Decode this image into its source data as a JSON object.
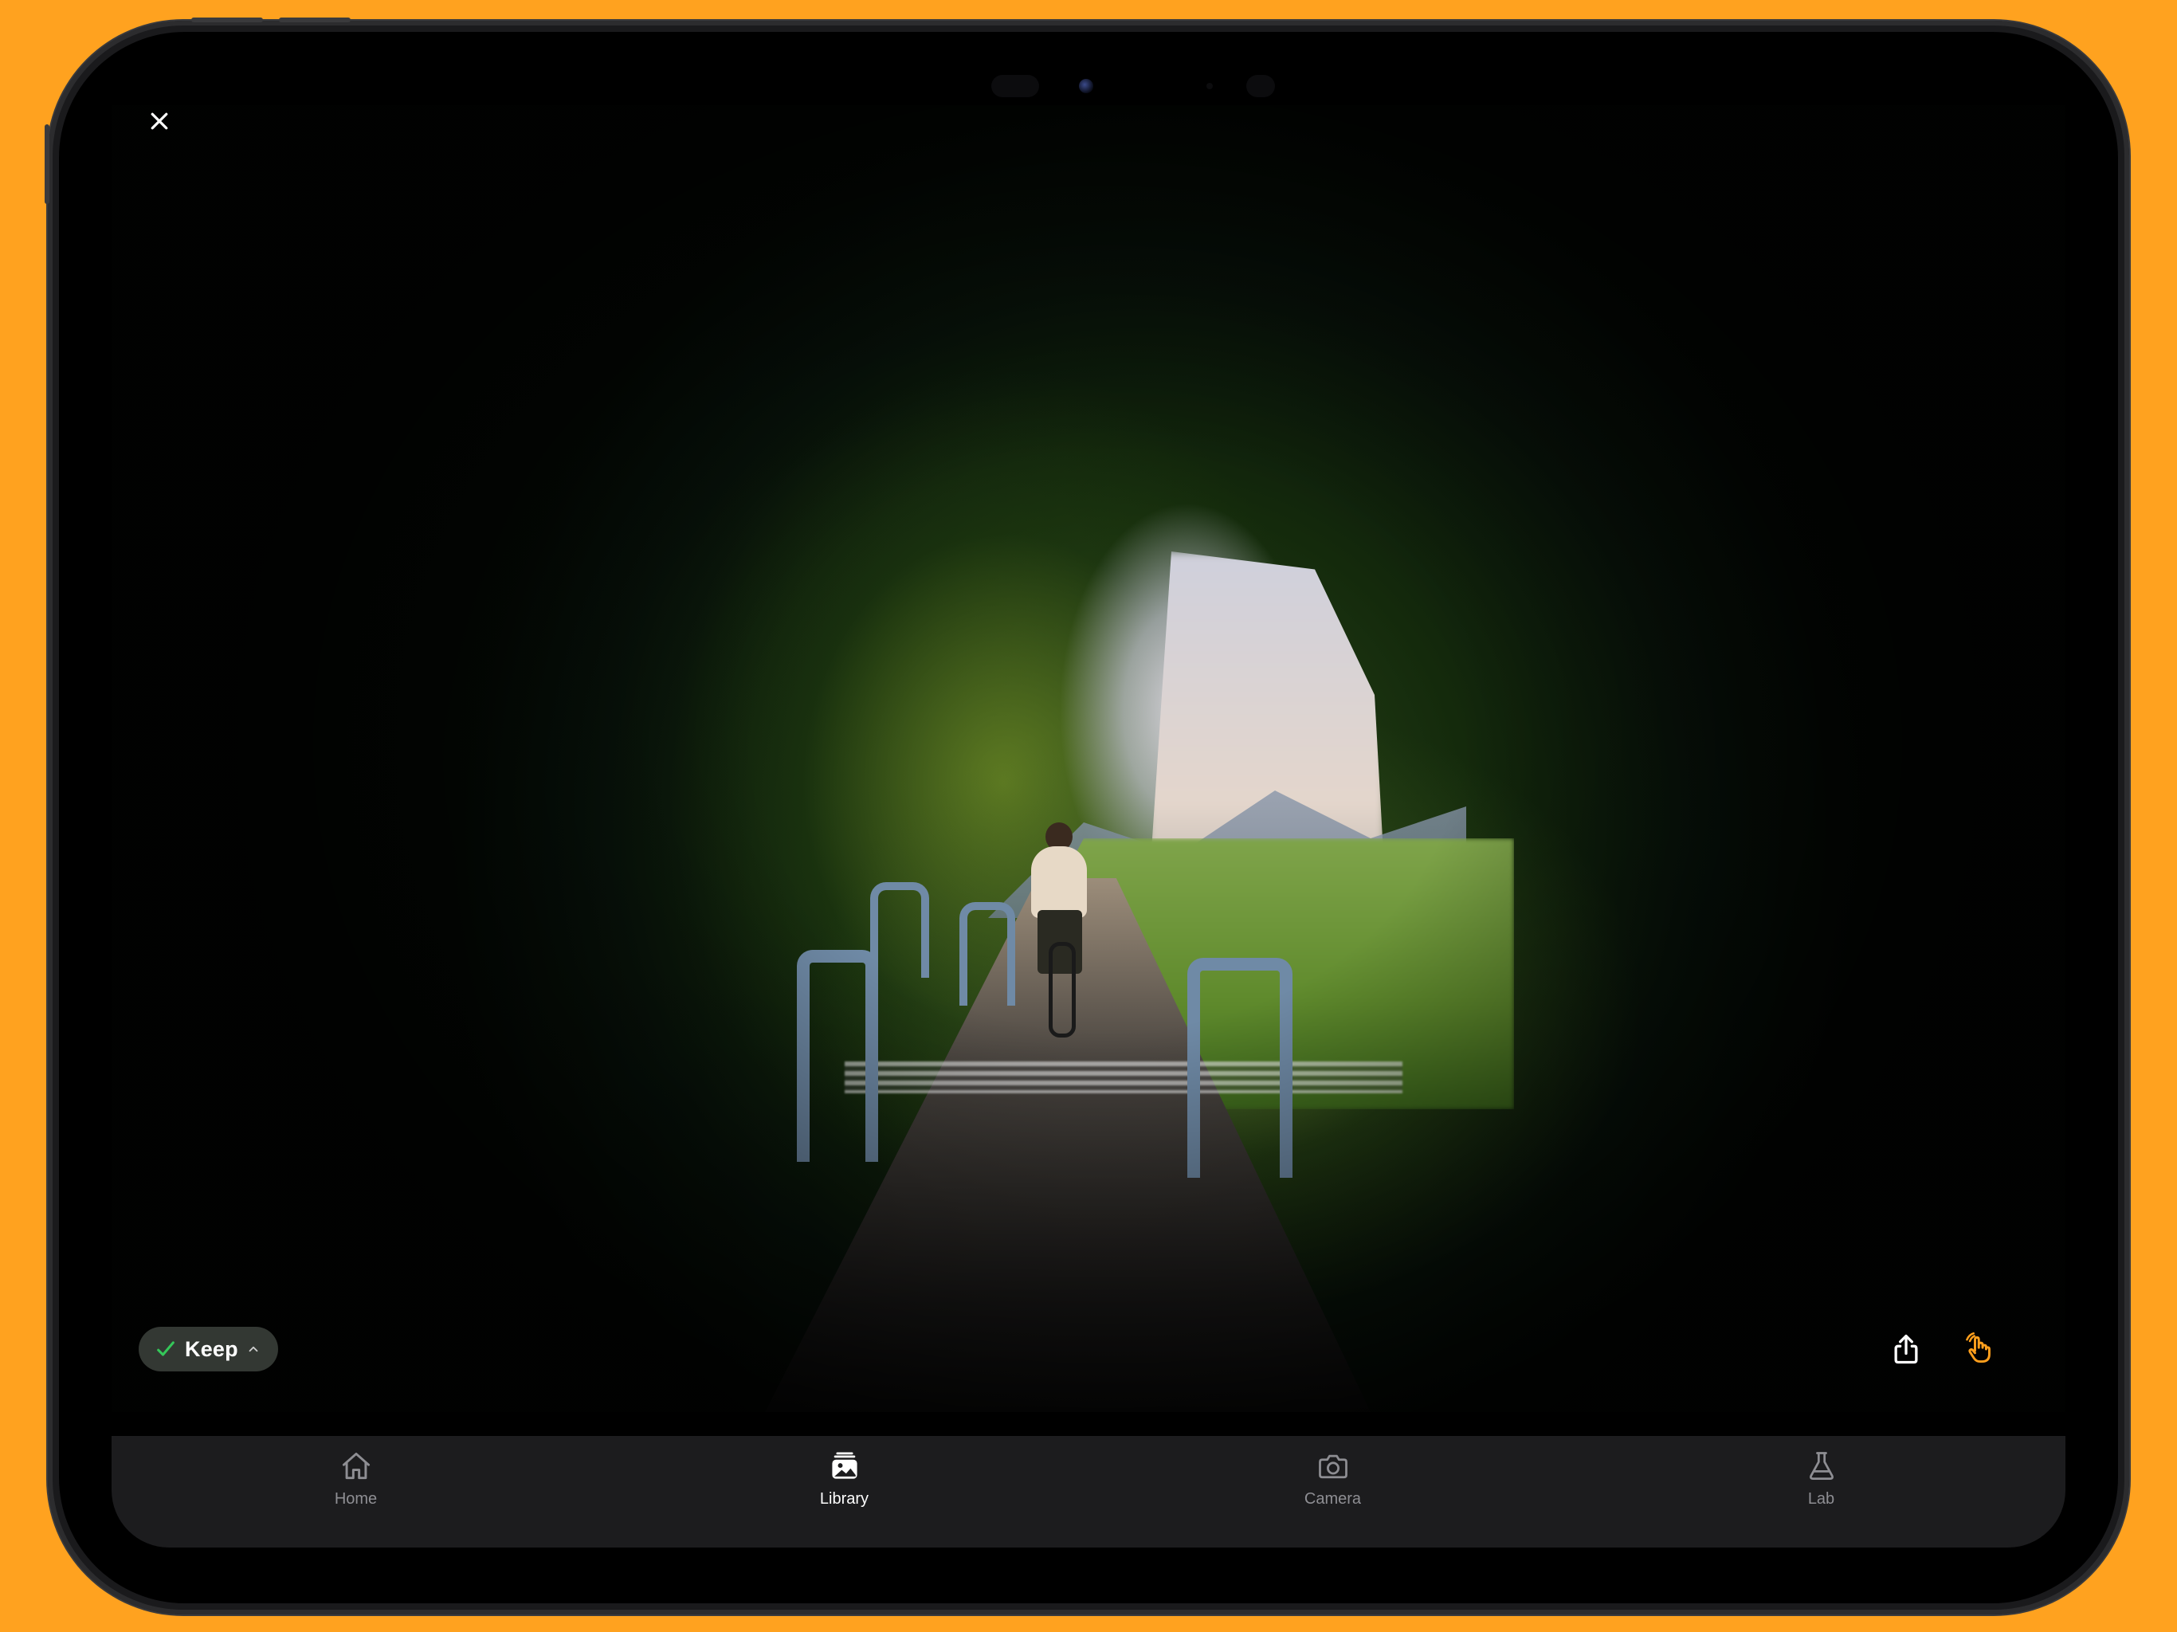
{
  "device": {
    "frame_color": "#1a1a1c",
    "background": "#ffa21f"
  },
  "viewer": {
    "close_icon": "close-icon",
    "keep_status": {
      "label": "Keep",
      "check_color": "#34c759"
    },
    "actions": [
      {
        "name": "share",
        "icon": "share-icon",
        "color": "#ffffff"
      },
      {
        "name": "gesture",
        "icon": "hand-gesture-icon",
        "color": "#ff9f1c"
      }
    ]
  },
  "tabbar": {
    "tabs": [
      {
        "label": "Home",
        "icon": "house-icon",
        "active": false
      },
      {
        "label": "Library",
        "icon": "photo-stack-icon",
        "active": true
      },
      {
        "label": "Camera",
        "icon": "camera-icon",
        "active": false
      },
      {
        "label": "Lab",
        "icon": "flask-icon",
        "active": false
      }
    ]
  }
}
